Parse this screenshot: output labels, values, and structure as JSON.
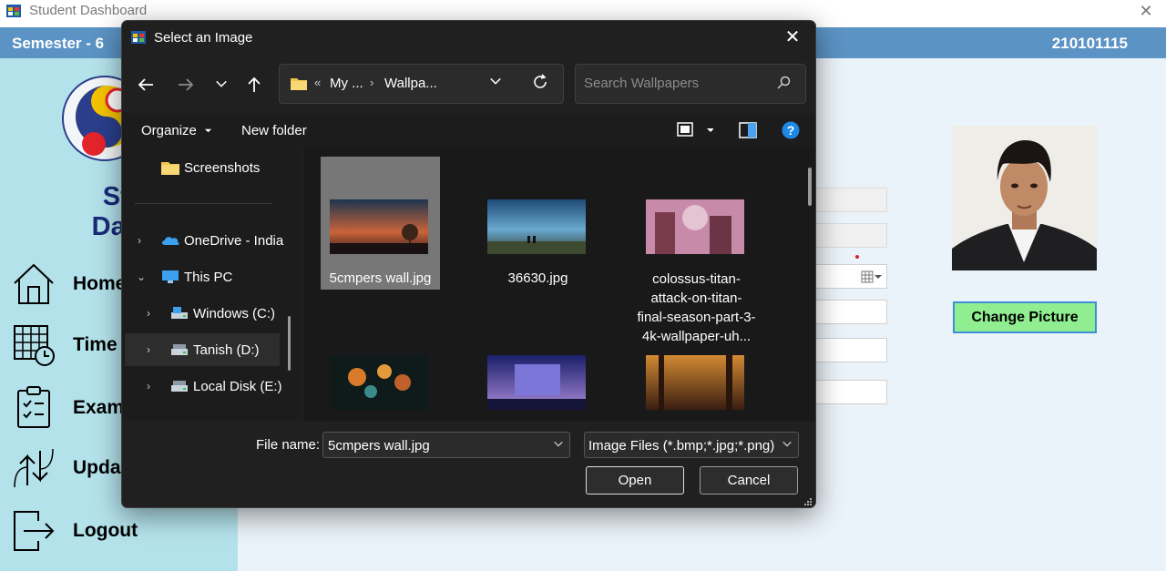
{
  "app": {
    "title": "Student Dashboard",
    "close_icon": "close-icon"
  },
  "topbar": {
    "semester": "Semester - 6",
    "roll_number": "210101115"
  },
  "sidebar": {
    "title_line1": "Stud",
    "title_line2": "Dashb",
    "items": [
      {
        "label": "Home",
        "icon": "home-icon"
      },
      {
        "label": "Time",
        "icon": "timetable-icon"
      },
      {
        "label": "Exam",
        "icon": "exam-clipboard-icon"
      },
      {
        "label": "Upda",
        "icon": "update-arrows-icon"
      },
      {
        "label": "Logout",
        "icon": "logout-icon"
      }
    ]
  },
  "profile": {
    "change_picture_label": "Change Picture"
  },
  "dialog": {
    "title": "Select an Image",
    "address": {
      "overflow": "«",
      "crumbs": [
        "My ...",
        "Wallpa..."
      ]
    },
    "search_placeholder": "Search Wallpapers",
    "commands": {
      "organize": "Organize",
      "new_folder": "New folder"
    },
    "tree": [
      {
        "label": "Screenshots",
        "icon": "folder-icon"
      },
      {
        "label": "OneDrive - India",
        "icon": "onedrive-icon"
      },
      {
        "label": "This PC",
        "icon": "monitor-icon"
      },
      {
        "label": "Windows (C:)",
        "icon": "drive-icon"
      },
      {
        "label": "Tanish (D:)",
        "icon": "drive-icon"
      },
      {
        "label": "Local Disk (E:)",
        "icon": "drive-icon"
      }
    ],
    "files": [
      {
        "name": "5cmpers wall.jpg"
      },
      {
        "name": "36630.jpg"
      },
      {
        "name": "colossus-titan-attack-on-titan-final-season-part-3-4k-wallpaper-uh..."
      },
      {
        "name": ""
      },
      {
        "name": ""
      },
      {
        "name": ""
      }
    ],
    "file_name_label": "File name:",
    "file_name_value": "5cmpers wall.jpg",
    "file_type": "Image Files (*.bmp;*.jpg;*.png)",
    "open_label": "Open",
    "cancel_label": "Cancel"
  },
  "colors": {
    "topbar": "#5b93c4",
    "sidebar": "#b4e2eb",
    "title_blue": "#1a2a7a",
    "change_picture_bg": "#90ee90",
    "dialog_bg": "#202020"
  }
}
